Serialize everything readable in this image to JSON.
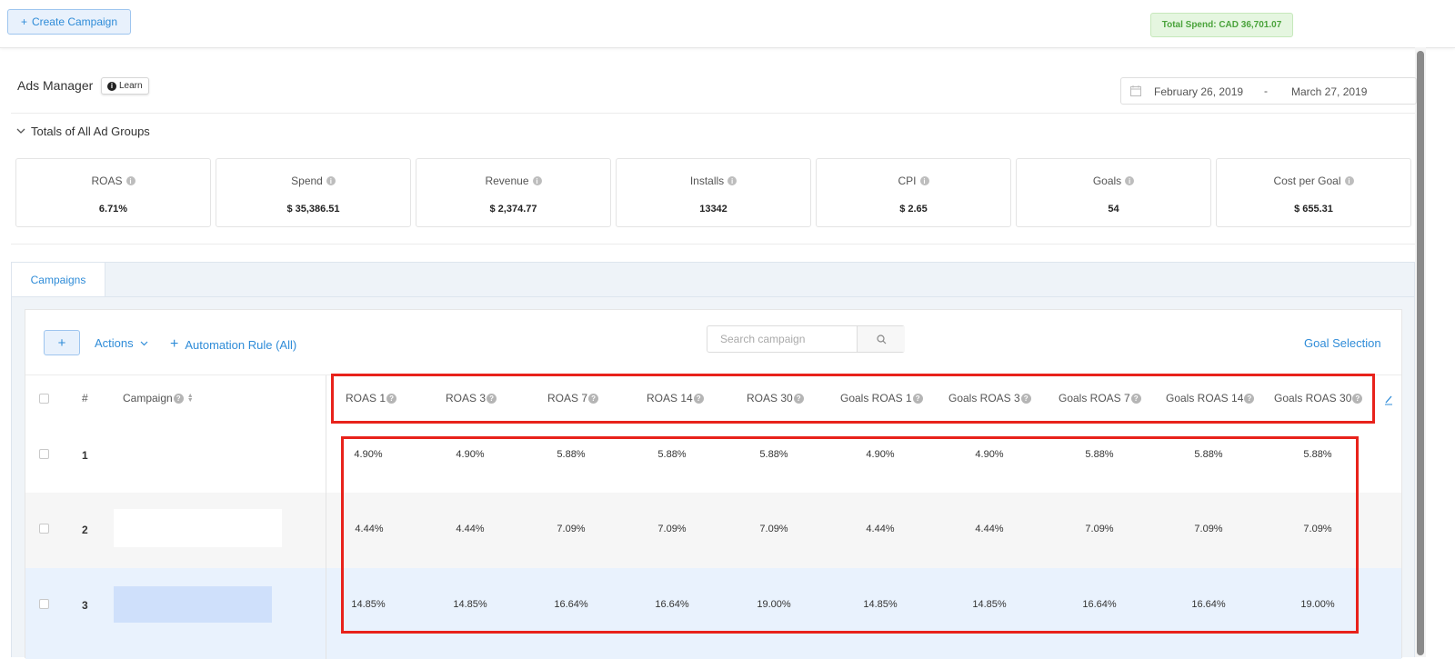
{
  "topbar": {
    "create_label": "Create Campaign",
    "total_spend": "Total Spend: CAD 36,701.07"
  },
  "header": {
    "title": "Ads Manager",
    "learn_label": "Learn",
    "date_from": "February 26, 2019",
    "date_sep": "-",
    "date_to": "March 27, 2019"
  },
  "totals": {
    "label": "Totals of All Ad Groups",
    "metrics": [
      {
        "label": "ROAS",
        "value": "6.71%"
      },
      {
        "label": "Spend",
        "value": "$ 35,386.51"
      },
      {
        "label": "Revenue",
        "value": "$ 2,374.77"
      },
      {
        "label": "Installs",
        "value": "13342"
      },
      {
        "label": "CPI",
        "value": "$ 2.65"
      },
      {
        "label": "Goals",
        "value": "54"
      },
      {
        "label": "Cost per Goal",
        "value": "$ 655.31"
      }
    ]
  },
  "tabs": [
    {
      "label": "Campaigns",
      "active": true
    }
  ],
  "toolbar": {
    "actions_label": "Actions",
    "automation_label": "Automation Rule (All)",
    "search_placeholder": "Search campaign",
    "goal_selection_label": "Goal Selection"
  },
  "table": {
    "num_header": "#",
    "campaign_header": "Campaign",
    "columns": [
      "ROAS 1",
      "ROAS 3",
      "ROAS 7",
      "ROAS 14",
      "ROAS 30",
      "Goals ROAS 1",
      "Goals ROAS 3",
      "Goals ROAS 7",
      "Goals ROAS 14",
      "Goals ROAS 30"
    ],
    "rows": [
      {
        "num": "1",
        "values": [
          "4.90%",
          "4.90%",
          "5.88%",
          "5.88%",
          "5.88%",
          "4.90%",
          "4.90%",
          "5.88%",
          "5.88%",
          "5.88%"
        ]
      },
      {
        "num": "2",
        "values": [
          "4.44%",
          "4.44%",
          "7.09%",
          "7.09%",
          "7.09%",
          "4.44%",
          "4.44%",
          "7.09%",
          "7.09%",
          "7.09%"
        ]
      },
      {
        "num": "3",
        "values": [
          "14.85%",
          "14.85%",
          "16.64%",
          "16.64%",
          "19.00%",
          "14.85%",
          "14.85%",
          "16.64%",
          "16.64%",
          "19.00%"
        ]
      }
    ]
  },
  "colors": {
    "accent": "#2f8cd8",
    "highlight_box": "#e8221b",
    "total_spend_text": "#4aa33b",
    "selected_row": "#e9f2fd"
  }
}
